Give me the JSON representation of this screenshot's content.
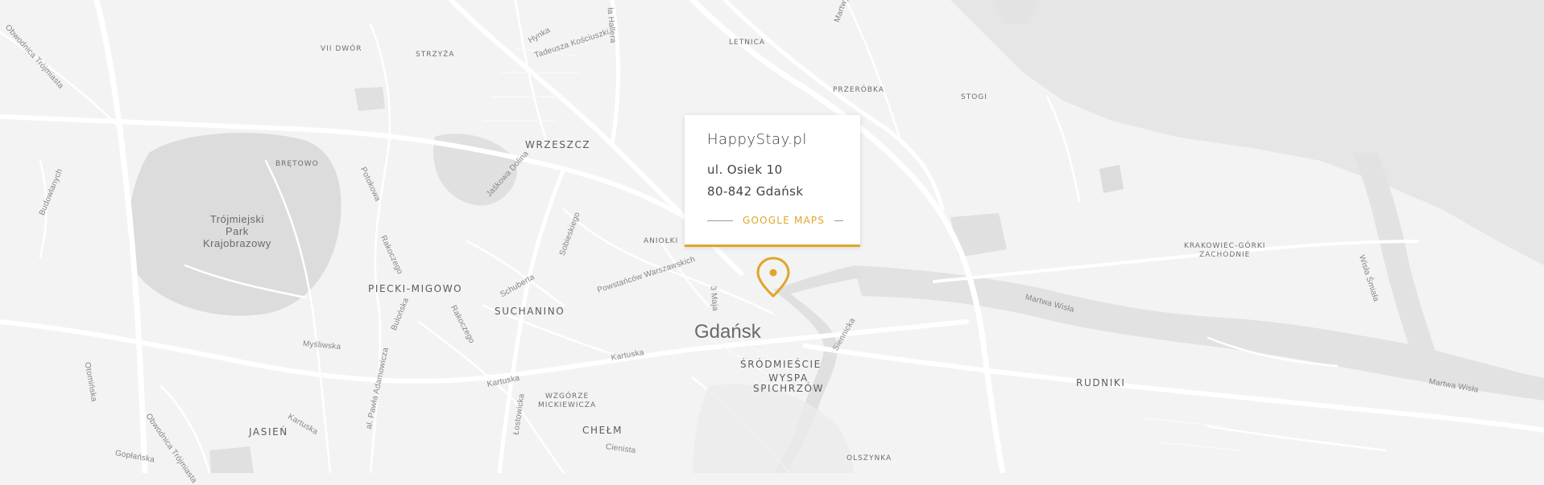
{
  "map": {
    "city_label": "Gdańsk",
    "district_labels": [
      "WRZESZCZ",
      "PIECKI-MIGOWO",
      "SUCHANINO",
      "ŚRÓDMIEŚCIE",
      "WYSPA\nSPICHRZÓW",
      "RUDNIKI",
      "CHEŁM",
      "JASIEŃ"
    ],
    "small_labels": [
      "VII DWÓR",
      "STRZYŻA",
      "LETNICA",
      "PRZERÓBKA",
      "STOGI",
      "BRĘTOWO",
      "ANIOŁKI",
      "KRAKOWIEC-GÓRKI\nZACHODNIE",
      "WZGÓRZE\nMICKIEWICZA",
      "OLSZYNKA"
    ],
    "park_label": "Trójmiejski\nPark\nKrajobrazowy",
    "street_labels": [
      "Hynka",
      "Tadeusza Kościuszki",
      "Jaśkowa Dolina",
      "Potokowa",
      "Rakoczego",
      "Sobieskiego",
      "Schuberta",
      "Powstańców Warszawskich",
      "3 Maja",
      "Rakoczego",
      "Bulońska",
      "Myśliwska",
      "Kartuska",
      "Kartuska",
      "Kartuska",
      "Łostowicka",
      "Cienista",
      "al. Pawła Adamowicza",
      "Obwodnica Trójmiasta",
      "Gopłańska",
      "Otomińska",
      "Budowlanych",
      "Martwa Wisła",
      "Wisła Śmiała",
      "Martwa Wisła",
      "Siennicka",
      "Obwodnica Trójmiasta",
      "Martwy",
      "ła Hallera"
    ],
    "colors": {
      "background": "#f3f3f3",
      "roads": "#ffffff",
      "water": "#e4e4e4",
      "park": "#d9d9d9",
      "accent": "#e0a528"
    }
  },
  "card": {
    "title": "HappyStay.pl",
    "street": "ul. Osiek 10",
    "postal_city": "80-842 Gdańsk",
    "link_label": "GOOGLE MAPS"
  },
  "marker": {
    "icon": "location-pin-icon"
  }
}
